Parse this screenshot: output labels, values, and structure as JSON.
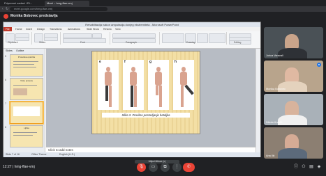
{
  "browser": {
    "tabs": [
      "Pripremni zadaci i Ri...",
      "Meet – hmg-ffae-vmj"
    ],
    "url": "meet.google.com/hmg-ffae-vmj"
  },
  "presenter": {
    "name": "Monika Bobovec predstavlja"
  },
  "ppt": {
    "title": "Rehabilitacija nakon amputacija donjeg ekstremiteta - Microsoft PowerPoint",
    "menu": [
      "File",
      "Home",
      "Insert",
      "Design",
      "Transitions",
      "Animations",
      "Slide Show",
      "Review",
      "View"
    ],
    "ribbon_groups": [
      "Clipboard",
      "Slides",
      "Font",
      "Paragraph",
      "Drawing",
      "Editing"
    ],
    "slide_panel_tabs": [
      "Slides",
      "Outline"
    ],
    "thumbnails": [
      {
        "num": "5",
        "title": "Protetska opskrba"
      },
      {
        "num": "6",
        "title": "Vrste proteza"
      },
      {
        "num": "7",
        "title": ""
      },
      {
        "num": "8",
        "title": "Lijčka"
      }
    ],
    "slide": {
      "figure_labels": [
        "e",
        "f",
        "g",
        "h"
      ],
      "caption": "Slika 3. Pravilno postavljanje bataljka"
    },
    "notes": "Click to add notes",
    "status": {
      "slide": "Slide 7 of 16",
      "theme": "Office Theme",
      "lang": "English (U.S.)"
    }
  },
  "participants": [
    {
      "name": "Jurica Varavali",
      "bg": "#4a5156",
      "skin": "#c9a48a",
      "shirt": "#2e3136"
    },
    {
      "name": "Monika Bobovec",
      "bg": "#b8a48c",
      "skin": "#e0b9a2",
      "shirt": "#e4d2bd"
    },
    {
      "name": "Nikola Hrvatić",
      "bg": "#a9b1b8",
      "skin": "#d8b39c",
      "shirt": "#f0f0f0"
    },
    {
      "name": "Ana Ilić",
      "bg": "#8c7f72",
      "skin": "#d6ab95",
      "shirt": "#5c6a7b"
    }
  ],
  "bottombar": {
    "time": "12:27",
    "meeting_code": "hmg-ffae-vmj",
    "hint": "Uključi titlove (c)"
  },
  "colors": {
    "meet_bg": "#202124",
    "end_call": "#ea4335",
    "ppt_file_tab": "#c0392b",
    "slide_bg": "#f3dfa5"
  }
}
